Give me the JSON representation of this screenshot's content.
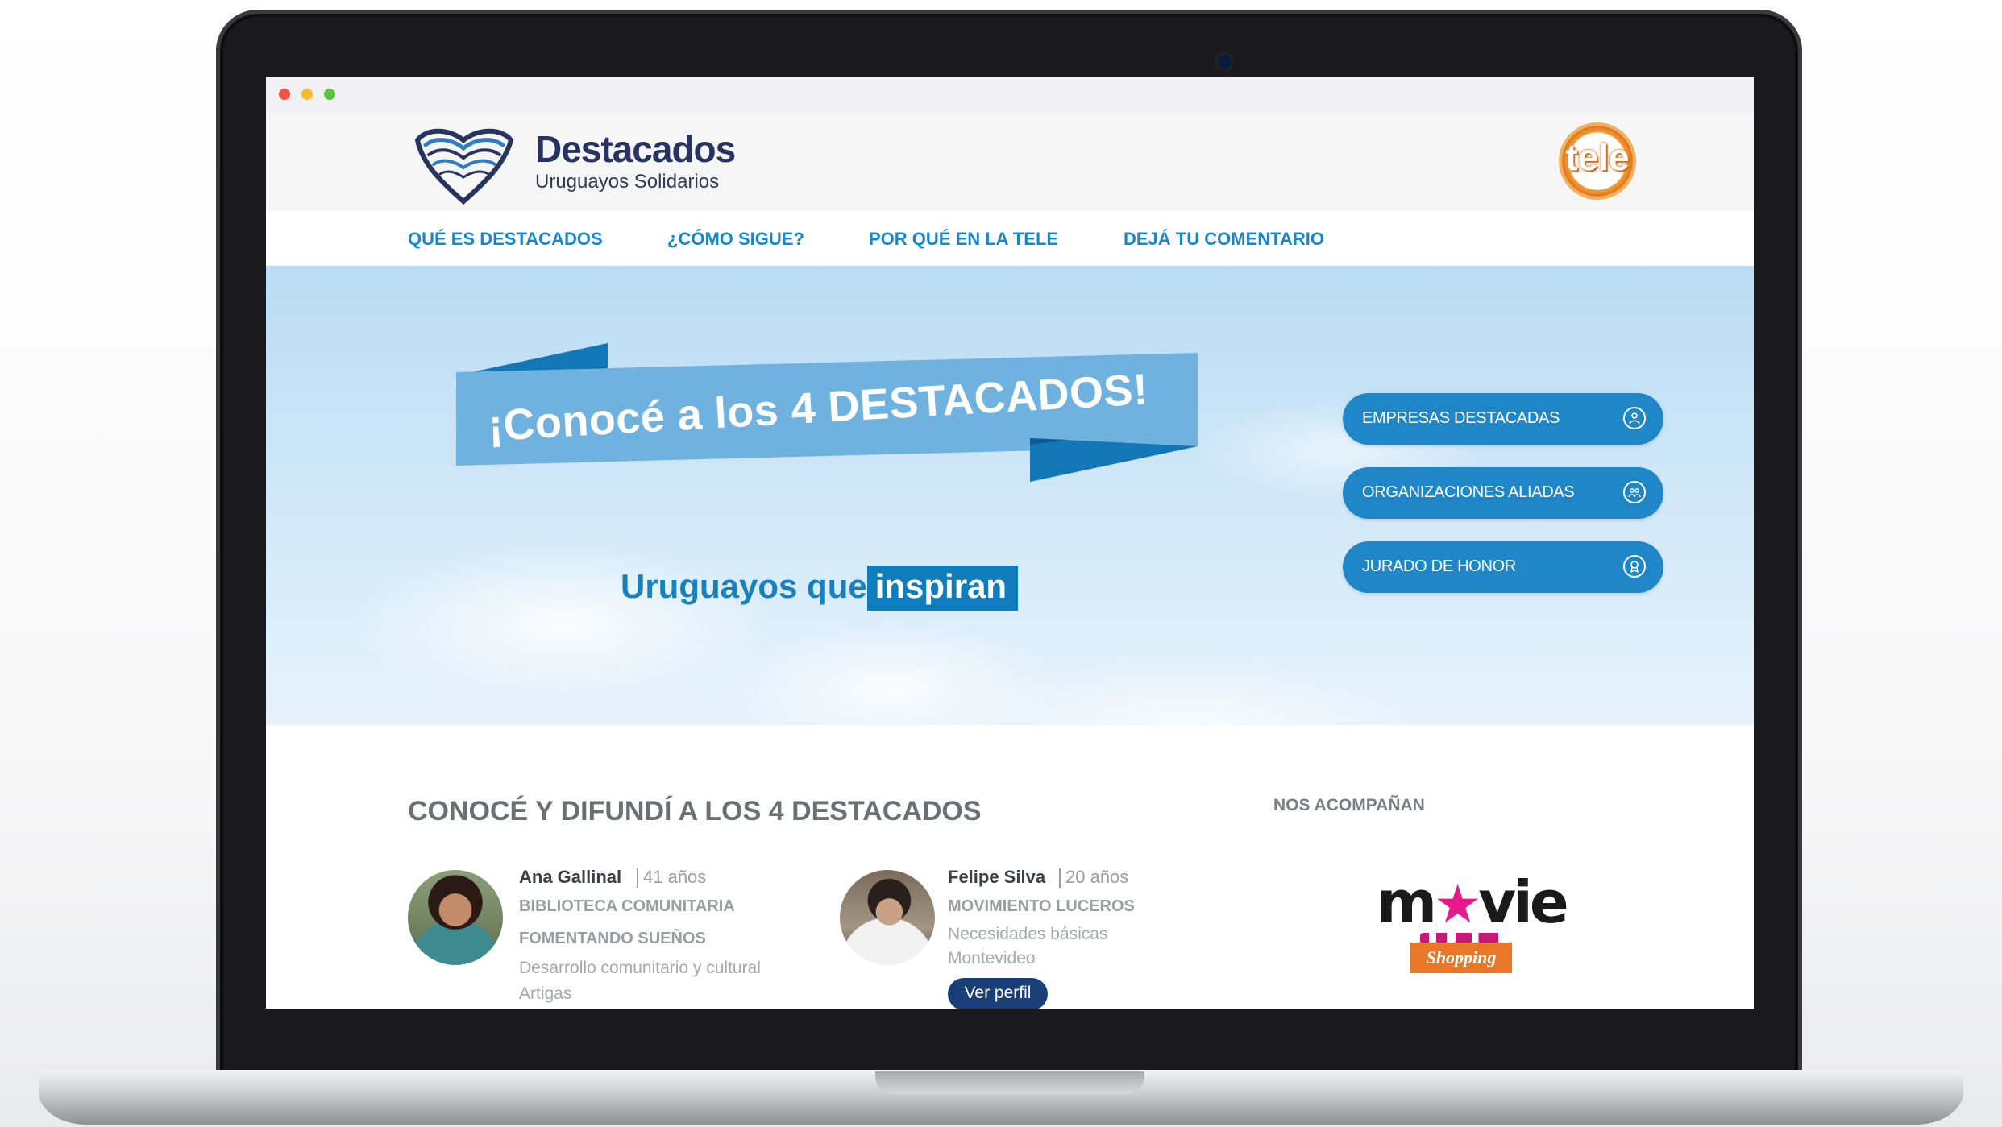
{
  "header": {
    "brand_title": "Destacados",
    "brand_tagline": "Uruguayos Solidarios",
    "partner_logo_text": "tele"
  },
  "nav": {
    "items": [
      {
        "label": "QUÉ ES DESTACADOS"
      },
      {
        "label": "¿CÓMO SIGUE?"
      },
      {
        "label": "POR QUÉ EN LA TELE"
      },
      {
        "label": "DEJÁ TU COMENTARIO"
      }
    ]
  },
  "hero": {
    "banner_text": "¡Conocé a los 4 DESTACADOS!",
    "subtitle_prefix": "Uruguayos que",
    "subtitle_highlight": "inspiran",
    "buttons": [
      {
        "label": "EMPRESAS DESTACADAS",
        "icon": "person-icon"
      },
      {
        "label": "ORGANIZACIONES ALIADAS",
        "icon": "group-icon"
      },
      {
        "label": "JURADO DE HONOR",
        "icon": "award-icon"
      }
    ]
  },
  "main": {
    "section_title": "CONOCÉ Y DIFUNDÍ A LOS 4 DESTACADOS",
    "profiles": [
      {
        "name": "Ana Gallinal",
        "age": "41 años",
        "org": "BIBLIOTECA COMUNITARIA",
        "project": "FOMENTANDO SUEÑOS",
        "category": "Desarrollo comunitario y cultural",
        "location": "Artigas"
      },
      {
        "name": "Felipe Silva",
        "age": "20 años",
        "org": "MOVIMIENTO LUCEROS",
        "category": "Necesidades básicas",
        "location": "Montevideo",
        "button_label": "Ver perfil"
      }
    ]
  },
  "sponsors": {
    "title": "NOS ACOMPAÑAN",
    "logo_main_prefix": "m",
    "logo_main_suffix": "vie",
    "logo_sub": "Shopping"
  },
  "colors": {
    "accent": "#1687c7",
    "navy": "#26345f",
    "button_blue": "#1f86c8",
    "banner_blue": "#6eb0de",
    "orange": "#e8772a",
    "magenta": "#e61a8a"
  }
}
